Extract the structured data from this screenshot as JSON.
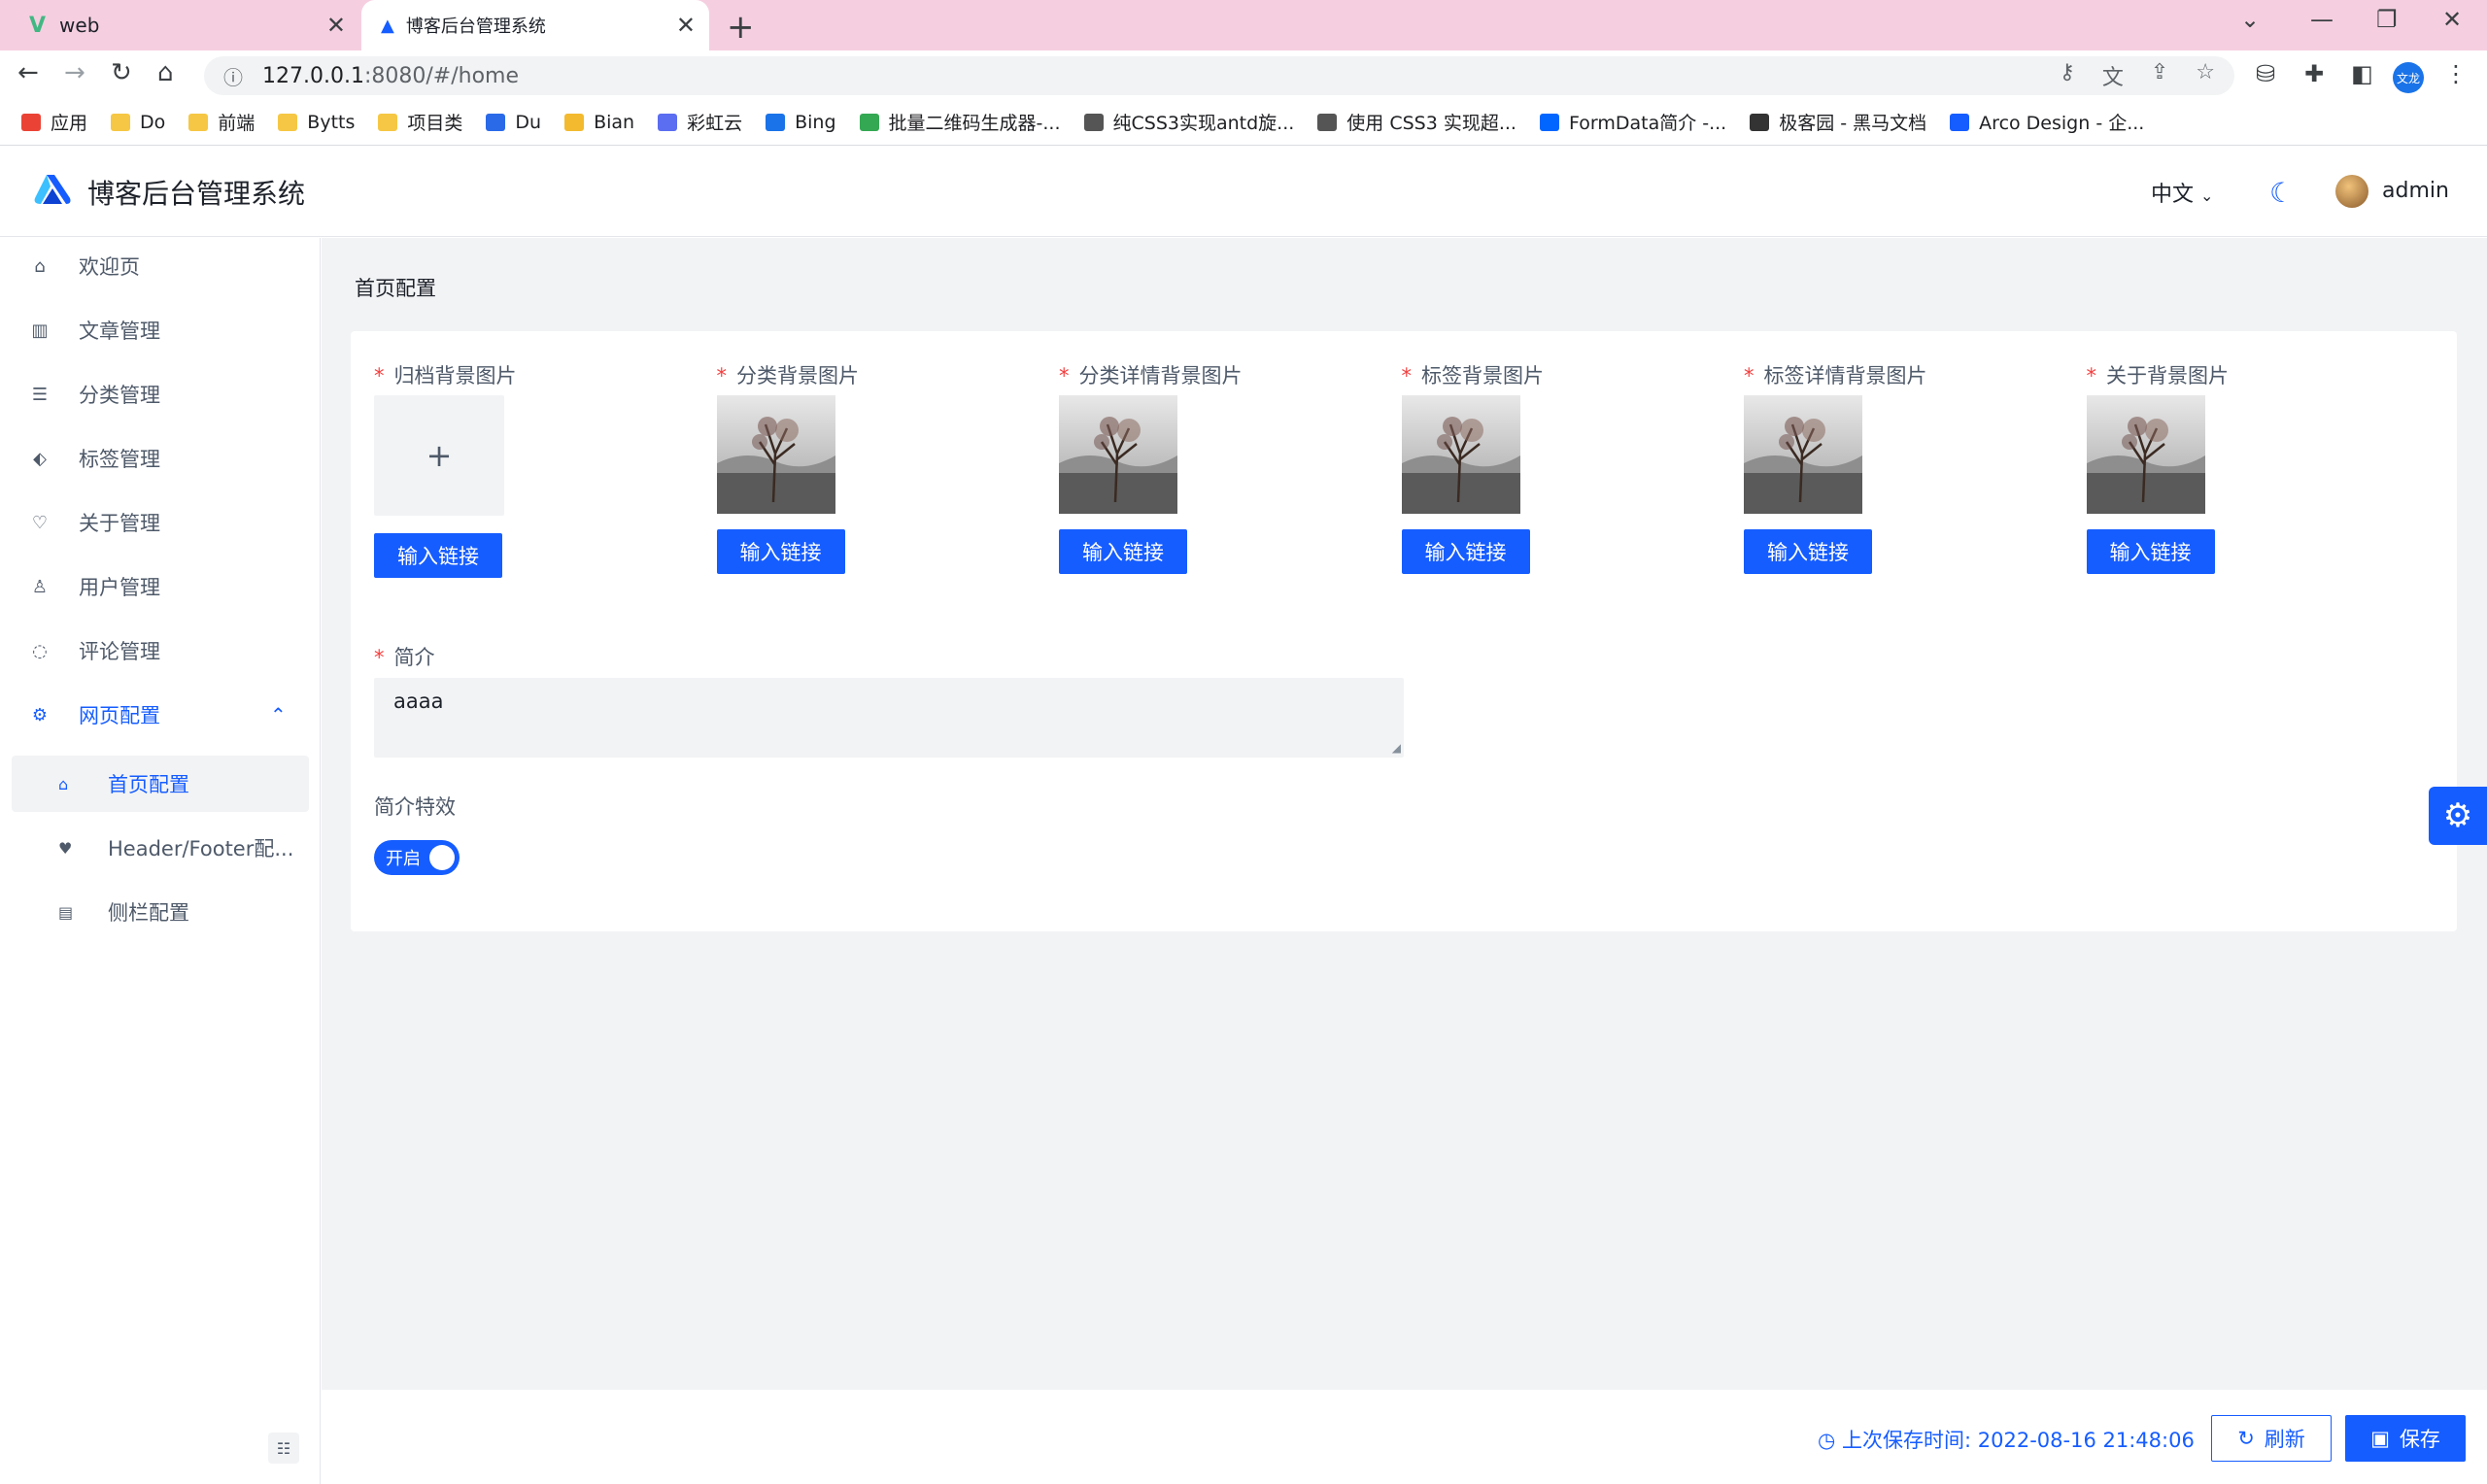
{
  "browser": {
    "tabs": [
      {
        "title": "web",
        "icon": "vue-logo-icon"
      },
      {
        "title": "博客后台管理系统",
        "icon": "arco-logo-icon"
      }
    ],
    "url_host": "127.0.0.1",
    "url_rest": ":8080/#/home",
    "bookmarks": [
      {
        "label": "应用",
        "icon": "apps-grid-icon"
      },
      {
        "label": "Do",
        "icon": "folder-icon"
      },
      {
        "label": "前端",
        "icon": "folder-icon"
      },
      {
        "label": "Bytts",
        "icon": "folder-icon"
      },
      {
        "label": "项目类",
        "icon": "folder-icon"
      },
      {
        "label": "Du",
        "icon": "translate-icon"
      },
      {
        "label": "Bian",
        "icon": "binance-icon"
      },
      {
        "label": "彩虹云",
        "icon": "cloud-icon"
      },
      {
        "label": "Bing",
        "icon": "search-icon"
      },
      {
        "label": "批量二维码生成器-...",
        "icon": "qrcode-icon"
      },
      {
        "label": "纯CSS3实现antd旋...",
        "icon": "codepen-icon"
      },
      {
        "label": "使用 CSS3 实现超...",
        "icon": "codepen-icon"
      },
      {
        "label": "FormData简介 -...",
        "icon": "zhihu-icon"
      },
      {
        "label": "极客园 - 黑马文档",
        "icon": "github-icon"
      },
      {
        "label": "Arco Design - 企...",
        "icon": "arco-logo-icon"
      }
    ],
    "profile_label": "文龙"
  },
  "header": {
    "title": "博客后台管理系统",
    "language": "中文",
    "username": "admin"
  },
  "sidebar": {
    "items": [
      {
        "label": "欢迎页",
        "icon": "home-icon"
      },
      {
        "label": "文章管理",
        "icon": "book-icon"
      },
      {
        "label": "分类管理",
        "icon": "list-icon"
      },
      {
        "label": "标签管理",
        "icon": "tag-icon"
      },
      {
        "label": "关于管理",
        "icon": "heart-icon"
      },
      {
        "label": "用户管理",
        "icon": "user-icon"
      },
      {
        "label": "评论管理",
        "icon": "message-icon"
      },
      {
        "label": "网页配置",
        "icon": "settings-icon"
      }
    ],
    "sub_items": [
      {
        "label": "首页配置",
        "icon": "home-icon"
      },
      {
        "label": "Header/Footer配...",
        "icon": "heart-icon"
      },
      {
        "label": "侧栏配置",
        "icon": "sidebar-icon"
      }
    ]
  },
  "main": {
    "breadcrumb": "首页配置",
    "image_fields": [
      {
        "label": "归档背景图片",
        "has_image": false
      },
      {
        "label": "分类背景图片",
        "has_image": true
      },
      {
        "label": "分类详情背景图片",
        "has_image": true
      },
      {
        "label": "标签背景图片",
        "has_image": true
      },
      {
        "label": "标签详情背景图片",
        "has_image": true
      },
      {
        "label": "关于背景图片",
        "has_image": true
      }
    ],
    "link_button_label": "输入链接",
    "intro_label": "简介",
    "intro_value": "aaaa",
    "effect_label": "简介特效",
    "effect_switch_text": "开启",
    "effect_on": true
  },
  "footer": {
    "last_save_label": "上次保存时间:",
    "last_save_time": "2022-08-16 21:48:06",
    "refresh_label": "刷新",
    "save_label": "保存"
  },
  "colors": {
    "primary": "#165dff",
    "required": "#f53f3f",
    "tabbar": "#f5cfe0"
  }
}
